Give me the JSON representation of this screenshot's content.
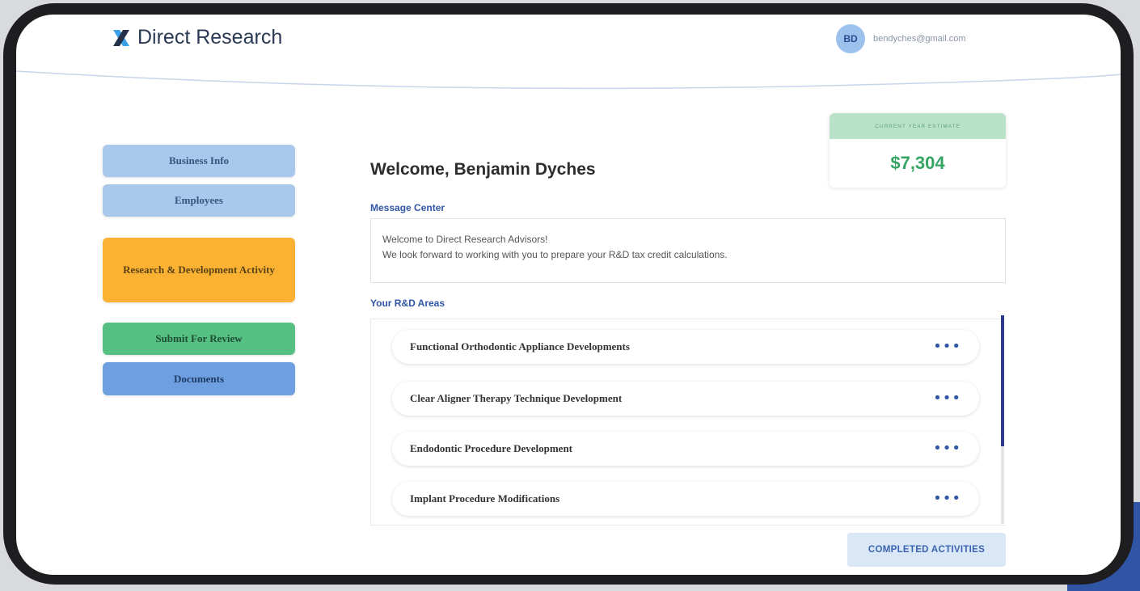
{
  "header": {
    "brand_name": "Direct Research",
    "user_initials": "BD",
    "user_email": "bendyches@gmail.com"
  },
  "sidebar": {
    "items": [
      {
        "label": "Business Info"
      },
      {
        "label": "Employees"
      },
      {
        "label": "Research & Development Activity"
      },
      {
        "label": "Submit For Review"
      },
      {
        "label": "Documents"
      }
    ]
  },
  "estimate": {
    "label": "CURRENT YEAR ESTIMATE",
    "value": "$7,304"
  },
  "main": {
    "welcome": "Welcome, Benjamin Dyches",
    "message_center_title": "Message Center",
    "messages": [
      "Welcome to Direct Research Advisors!",
      "We look forward to working with you to prepare your R&D tax credit calculations."
    ],
    "areas_title": "Your R&D Areas",
    "areas": [
      {
        "label": "Functional Orthodontic Appliance Developments"
      },
      {
        "label": "Clear Aligner Therapy Technique Development"
      },
      {
        "label": "Endodontic Procedure Development"
      },
      {
        "label": "Implant Procedure Modifications"
      }
    ],
    "more_icon": "•••",
    "completed_button": "COMPLETED ACTIVITIES"
  },
  "colors": {
    "brand_blue": "#2f55a4",
    "brand_x": "#3aa0ea",
    "nav_blue": "#a9c8ec",
    "nav_orange": "#fbb233",
    "nav_green": "#56bf82",
    "nav_docs": "#6e9fe0",
    "estimate_green": "#35a464"
  }
}
